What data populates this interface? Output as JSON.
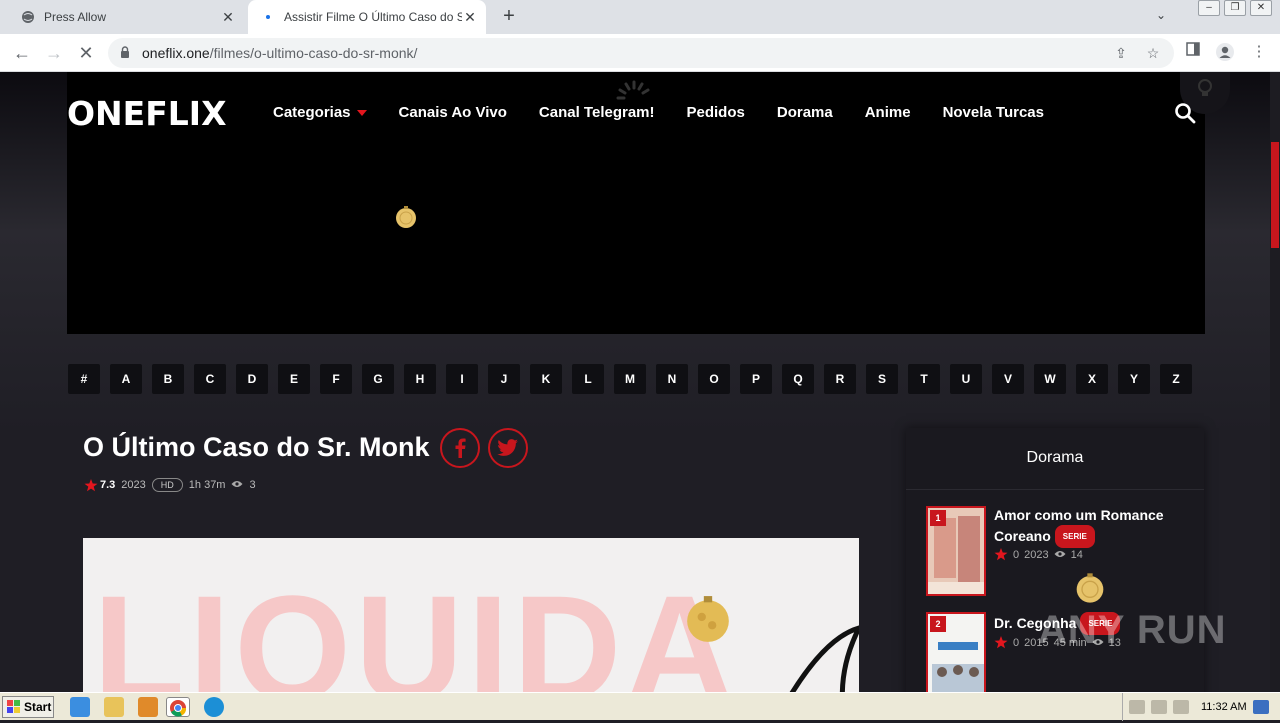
{
  "browser": {
    "tabs": [
      {
        "title": "Press Allow",
        "active": false
      },
      {
        "title": "Assistir Filme O Último Caso do Sr. M",
        "active": true
      }
    ],
    "url_host": "oneflix.one",
    "url_path": "/filmes/o-ultimo-caso-do-sr-monk/"
  },
  "site": {
    "logo": "ONEFLIX",
    "nav": [
      "Categorias",
      "Canais Ao Vivo",
      "Canal Telegram!",
      "Pedidos",
      "Dorama",
      "Anime",
      "Novela Turcas"
    ],
    "alphabet": [
      "#",
      "A",
      "B",
      "C",
      "D",
      "E",
      "F",
      "G",
      "H",
      "I",
      "J",
      "K",
      "L",
      "M",
      "N",
      "O",
      "P",
      "Q",
      "R",
      "S",
      "T",
      "U",
      "V",
      "W",
      "X",
      "Y",
      "Z"
    ]
  },
  "movie": {
    "title": "O Último Caso do Sr. Monk",
    "rating": "7.3",
    "year": "2023",
    "quality": "HD",
    "duration": "1h 37m",
    "views": "3",
    "poster_text": "LIQUIDA"
  },
  "sidebar": {
    "heading": "Dorama",
    "items": [
      {
        "rank": "1",
        "title": "Amor como um Romance Coreano",
        "badge": "SERIE",
        "rating": "0",
        "year": "2023",
        "extra": "",
        "views": "14"
      },
      {
        "rank": "2",
        "title": "Dr. Cegonha",
        "badge": "SERIE",
        "rating": "0",
        "year": "2015",
        "extra": "45 min",
        "views": "13"
      }
    ]
  },
  "watermark": "ANY RUN",
  "taskbar": {
    "start_label": "Start",
    "clock": "11:32 AM"
  },
  "colors": {
    "accent": "#c8161d",
    "background": "#1f1e25"
  }
}
